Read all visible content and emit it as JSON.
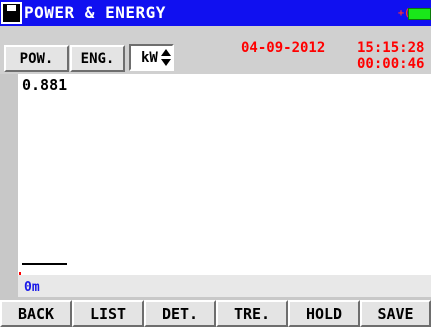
{
  "window": {
    "title": "POWER & ENERGY"
  },
  "toolbar": {
    "tab_power": "POW.",
    "tab_energy": "ENG.",
    "unit_value": "kW",
    "date": "04-09-2012",
    "time": "15:15:28",
    "elapsed": "00:00:46"
  },
  "plot": {
    "value_label": "0.881",
    "time_axis_label": "0m"
  },
  "footer": {
    "back": "BACK",
    "list": "LIST",
    "details": "DET.",
    "trend": "TRE.",
    "hold": "HOLD",
    "save": "SAVE"
  },
  "colors": {
    "titlebar": "#1010f0",
    "datetime": "#ff0000",
    "time_axis": "#1818e8",
    "battery": "#19e719"
  },
  "icons": {
    "app": "floppy-disk-icon",
    "power_status": "battery-icon",
    "charging": "plug-icon",
    "unit_select": "up-down-arrows-icon"
  }
}
